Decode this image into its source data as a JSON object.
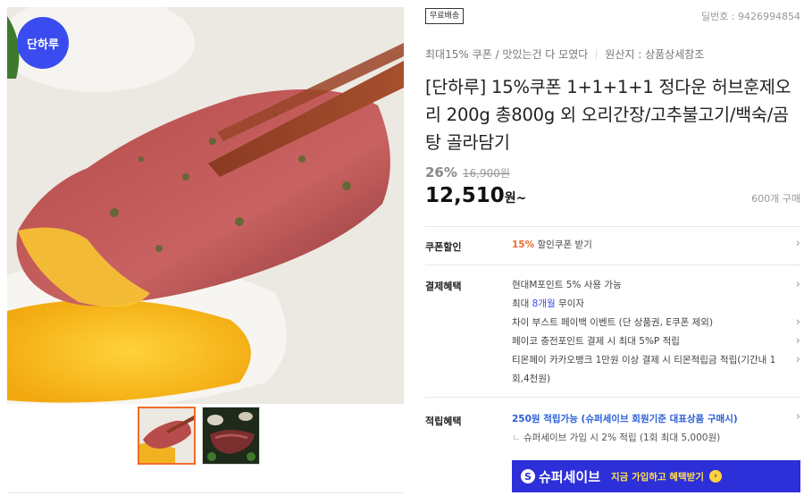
{
  "gallery": {
    "brand_badge": "단하루",
    "main_image": "smoked-duck-dipped-in-sauce-photo",
    "thumbnails": [
      "duck-slice-thumb",
      "sliced-meat-platter-thumb"
    ]
  },
  "product": {
    "shipping_tag": "무료배송",
    "deal_number": "딜번호 : 9426994854",
    "tagline": "최대15% 쿠폰 / 맛있는건 다 모였다",
    "origin": "원산지 : 상품상세참조",
    "title": "[단하루] 15%쿠폰 1+1+1+1 정다운 허브훈제오리 200g 총800g 외 오리간장/고추불고기/백숙/곰탕 골라담기",
    "discount_rate": "26%",
    "original_price": "16,900원",
    "sale_price": "12,510",
    "sale_unit": "원~",
    "sold_count": "600개 구매"
  },
  "coupon": {
    "label": "쿠폰할인",
    "rate": "15%",
    "text": "할인쿠폰 받기"
  },
  "payment": {
    "label": "결제혜택",
    "lines": [
      "현대M포인트 5% 사용 가능",
      "차이 부스트 페이백 이벤트 (단 상품권, E쿠폰 제외)",
      "페이코 충전포인트 결제 시 최대 5%P 적립",
      "티몬페이 카카오뱅크 1만원 이상 결제 시 티몬적립금 적립(기간내 1회,4천원)"
    ],
    "installment_prefix": "최대",
    "installment_months": "8개월",
    "installment_suffix": "무이자"
  },
  "reward": {
    "label": "적립혜택",
    "main": "250원 적립가능 (슈퍼세이브 회원기준 대표상품 구매시)",
    "sub": "슈퍼세이브 가입 시 2% 적립 (1회 최대 5,000원)"
  },
  "supersave": {
    "logo_letter": "S",
    "logo_text": "슈퍼세이브",
    "cta": "지금 가입하고 혜택받기",
    "arrow": "›"
  },
  "icons": {
    "chevron": "›"
  },
  "colors": {
    "accent_orange": "#f26b2a",
    "brand_blue": "#3a4cf0",
    "banner_blue": "#2d2fd9"
  }
}
